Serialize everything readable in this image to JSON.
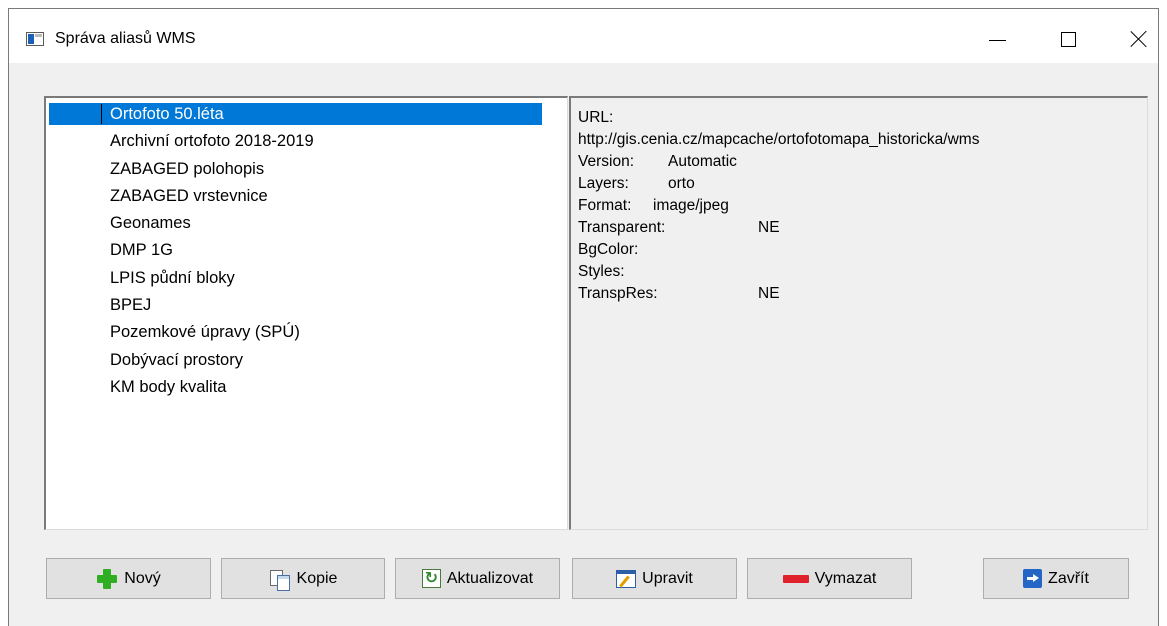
{
  "window": {
    "title": "Správa aliasů WMS"
  },
  "aliases": [
    "Ortofoto 50.léta",
    "Archivní ortofoto 2018-2019",
    "ZABAGED polohopis",
    "ZABAGED vrstevnice",
    "Geonames",
    "DMP 1G",
    "LPIS půdní bloky",
    "BPEJ",
    "Pozemkové úpravy (SPÚ)",
    "Dobývací prostory",
    "KM body kvalita"
  ],
  "details": {
    "url_label": "URL:",
    "url": "http://gis.cenia.cz/mapcache/ortofotomapa_historicka/wms",
    "version_label": "Version:",
    "version": "Automatic",
    "layers_label": "Layers:",
    "layers": "orto",
    "format_label": "Format:",
    "format": "image/jpeg",
    "transparent_label": "Transparent:",
    "transparent": "NE",
    "bgcolor_label": "BgColor:",
    "styles_label": "Styles:",
    "transpres_label": "TranspRes:",
    "transpres": "NE"
  },
  "buttons": {
    "new": "Nový",
    "copy": "Kopie",
    "refresh": "Aktualizovat",
    "edit": "Upravit",
    "delete": "Vymazat",
    "close": "Zavřít"
  },
  "icons": {
    "new": "plus-icon",
    "copy": "copy-icon",
    "refresh": "refresh-icon",
    "edit": "edit-icon",
    "delete": "minus-icon",
    "close": "exit-icon"
  },
  "colors": {
    "selection": "#0078d7",
    "dialog_bg": "#f0f0f0",
    "plus": "#2fae22",
    "delete": "#e0202a",
    "exit": "#2366c6"
  }
}
